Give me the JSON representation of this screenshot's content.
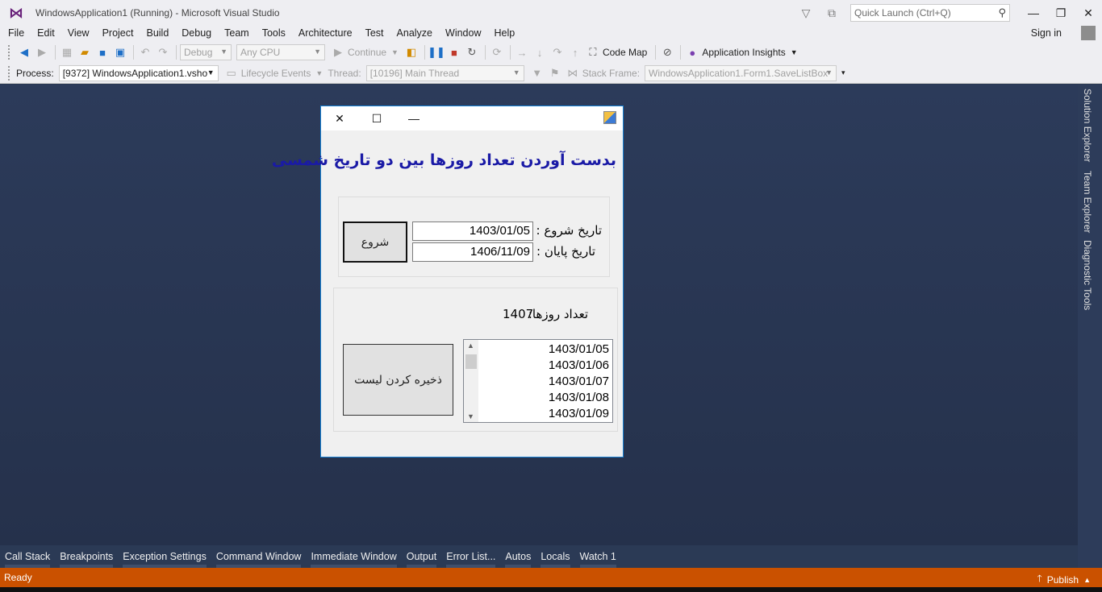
{
  "window": {
    "title": "WindowsApplication1 (Running) - Microsoft Visual Studio",
    "quick_launch_placeholder": "Quick Launch (Ctrl+Q)"
  },
  "menu": [
    "File",
    "Edit",
    "View",
    "Project",
    "Build",
    "Debug",
    "Team",
    "Tools",
    "Architecture",
    "Test",
    "Analyze",
    "Window",
    "Help"
  ],
  "signin": "Sign in",
  "toolbar1": {
    "config": "Debug",
    "platform": "Any CPU",
    "continue": "Continue",
    "code_map": "Code Map",
    "app_insights": "Application Insights"
  },
  "toolbar2": {
    "process_label": "Process:",
    "process_value": "[9372] WindowsApplication1.vsho",
    "lifecycle": "Lifecycle Events",
    "thread_label": "Thread:",
    "thread_value": "[10196] Main Thread",
    "stackframe_label": "Stack Frame:",
    "stackframe_value": "WindowsApplication1.Form1.SaveListBox"
  },
  "right_dock": [
    "Solution Explorer",
    "Team Explorer",
    "Diagnostic Tools"
  ],
  "bottom_tabs": [
    "Call Stack",
    "Breakpoints",
    "Exception Settings",
    "Command Window",
    "Immediate Window",
    "Output",
    "Error List...",
    "Autos",
    "Locals",
    "Watch 1"
  ],
  "status": {
    "text": "Ready",
    "publish": "Publish"
  },
  "form": {
    "heading": "بدست آوردن تعداد روزها بین دو تاریخ شمسی",
    "start_label": "تاریخ شروع :",
    "start_value": "1403/01/05",
    "end_label": "تاریخ پایان :",
    "end_value": "1406/11/09",
    "start_button": "شروع",
    "days_label": "تعداد روزها:",
    "days_value": "1407",
    "save_button": "ذخیره کردن لیست",
    "list_items": [
      "1403/01/05",
      "1403/01/06",
      "1403/01/07",
      "1403/01/08",
      "1403/01/09"
    ]
  }
}
